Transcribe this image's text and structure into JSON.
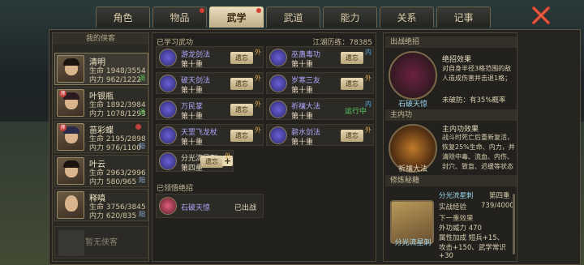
{
  "tabs": [
    {
      "label": "角色",
      "active": false,
      "dot": false
    },
    {
      "label": "物品",
      "active": false,
      "dot": true
    },
    {
      "label": "武学",
      "active": true,
      "dot": true
    },
    {
      "label": "武道",
      "active": false,
      "dot": false
    },
    {
      "label": "能力",
      "active": false,
      "dot": false
    },
    {
      "label": "关系",
      "active": false,
      "dot": false
    },
    {
      "label": "记事",
      "active": false,
      "dot": false
    }
  ],
  "heroes": {
    "header": "我的侠客",
    "list": [
      {
        "name": "清明",
        "hp": "生命 1948/3554",
        "mp": "内力 962/1222",
        "tag": "调",
        "badge": "",
        "selected": true
      },
      {
        "name": "叶银瓶",
        "hp": "生命 1892/3984",
        "mp": "内力 1078/1293",
        "tag": "调",
        "badge": "师",
        "selected": false
      },
      {
        "name": "苗彩蝶",
        "hp": "生命 2195/2898",
        "mp": "内力 976/1100",
        "tag": "阳",
        "badge": "师",
        "selected": false
      },
      {
        "name": "叶云",
        "hp": "生命 2963/2996",
        "mp": "内力 580/965",
        "tag": "阳",
        "badge": "",
        "selected": false
      },
      {
        "name": "释嗔",
        "hp": "生命 3756/3845",
        "mp": "内力 620/835",
        "tag": "阳",
        "badge": "",
        "selected": false
      }
    ],
    "empty": "暂无侠客"
  },
  "skills": {
    "learned_title": "已学习武功",
    "experience": "江湖历练：78385",
    "list": [
      {
        "name": "游龙剑法",
        "level": "第十重",
        "btn": "遗忘",
        "tag": "外",
        "tagtype": "w",
        "color": "#b0a8ff"
      },
      {
        "name": "巫蛊毒功",
        "level": "第十重",
        "btn": "遗忘",
        "tag": "内",
        "tagtype": "n",
        "color": "#b0a8ff"
      },
      {
        "name": "破天剑法",
        "level": "第十重",
        "btn": "遗忘",
        "tag": "外",
        "tagtype": "w",
        "color": "#b0a8ff"
      },
      {
        "name": "岁寒三友",
        "level": "第十重",
        "btn": "遗忘",
        "tag": "外",
        "tagtype": "w",
        "color": "#b0a8ff"
      },
      {
        "name": "万民掌",
        "level": "第十重",
        "btn": "遗忘",
        "tag": "外",
        "tagtype": "w",
        "color": "#b0a8ff"
      },
      {
        "name": "祈禳大法",
        "level": "第十重",
        "btn": "",
        "run": "运行中",
        "tag": "内",
        "tagtype": "n",
        "color": "#b0a8ff"
      },
      {
        "name": "天罡飞龙杖",
        "level": "第十重",
        "btn": "遗忘",
        "tag": "外",
        "tagtype": "w",
        "color": "#b0a8ff"
      },
      {
        "name": "碧水剑法",
        "level": "第十重",
        "btn": "遗忘",
        "tag": "外",
        "tagtype": "w",
        "color": "#b0a8ff"
      },
      {
        "name": "分光流星刺",
        "level": "第四重",
        "btn": "遗忘",
        "tag": "外",
        "tagtype": "w",
        "color": "#e6dac0",
        "plus": true
      }
    ],
    "awakened_title": "已领悟绝招",
    "ultimate": {
      "name": "石破天惊",
      "status": "已出战"
    }
  },
  "detail": {
    "ultimate_header": "出战绝招",
    "ultimate_name": "石破天惊",
    "ultimate_effect_title": "绝招效果",
    "ultimate_effect": "对自身半径3格范围的敌人造成伤害并击退1格；",
    "ultimate_effect2": "未破防：有35%概率",
    "inner_header": "主内功",
    "inner_name": "祈禳大法",
    "inner_effect_title": "主内功效果",
    "inner_effect": "战斗时死亡后重新复活，恢复25%生命、内力，并清除中毒、流血、内伤、封穴、致盲、迟缓等状态",
    "train_header": "修炼秘籍",
    "train_name": "分光流星刺",
    "train_level": "第四重",
    "train_exp_label": "实战经验",
    "train_exp": "739/4000",
    "next_label": "下一重效果",
    "power": "外功威力 470",
    "attr1": "属性加成  短兵+15、",
    "attr2": "攻击+150、武学常识",
    "attr3": "+30"
  }
}
